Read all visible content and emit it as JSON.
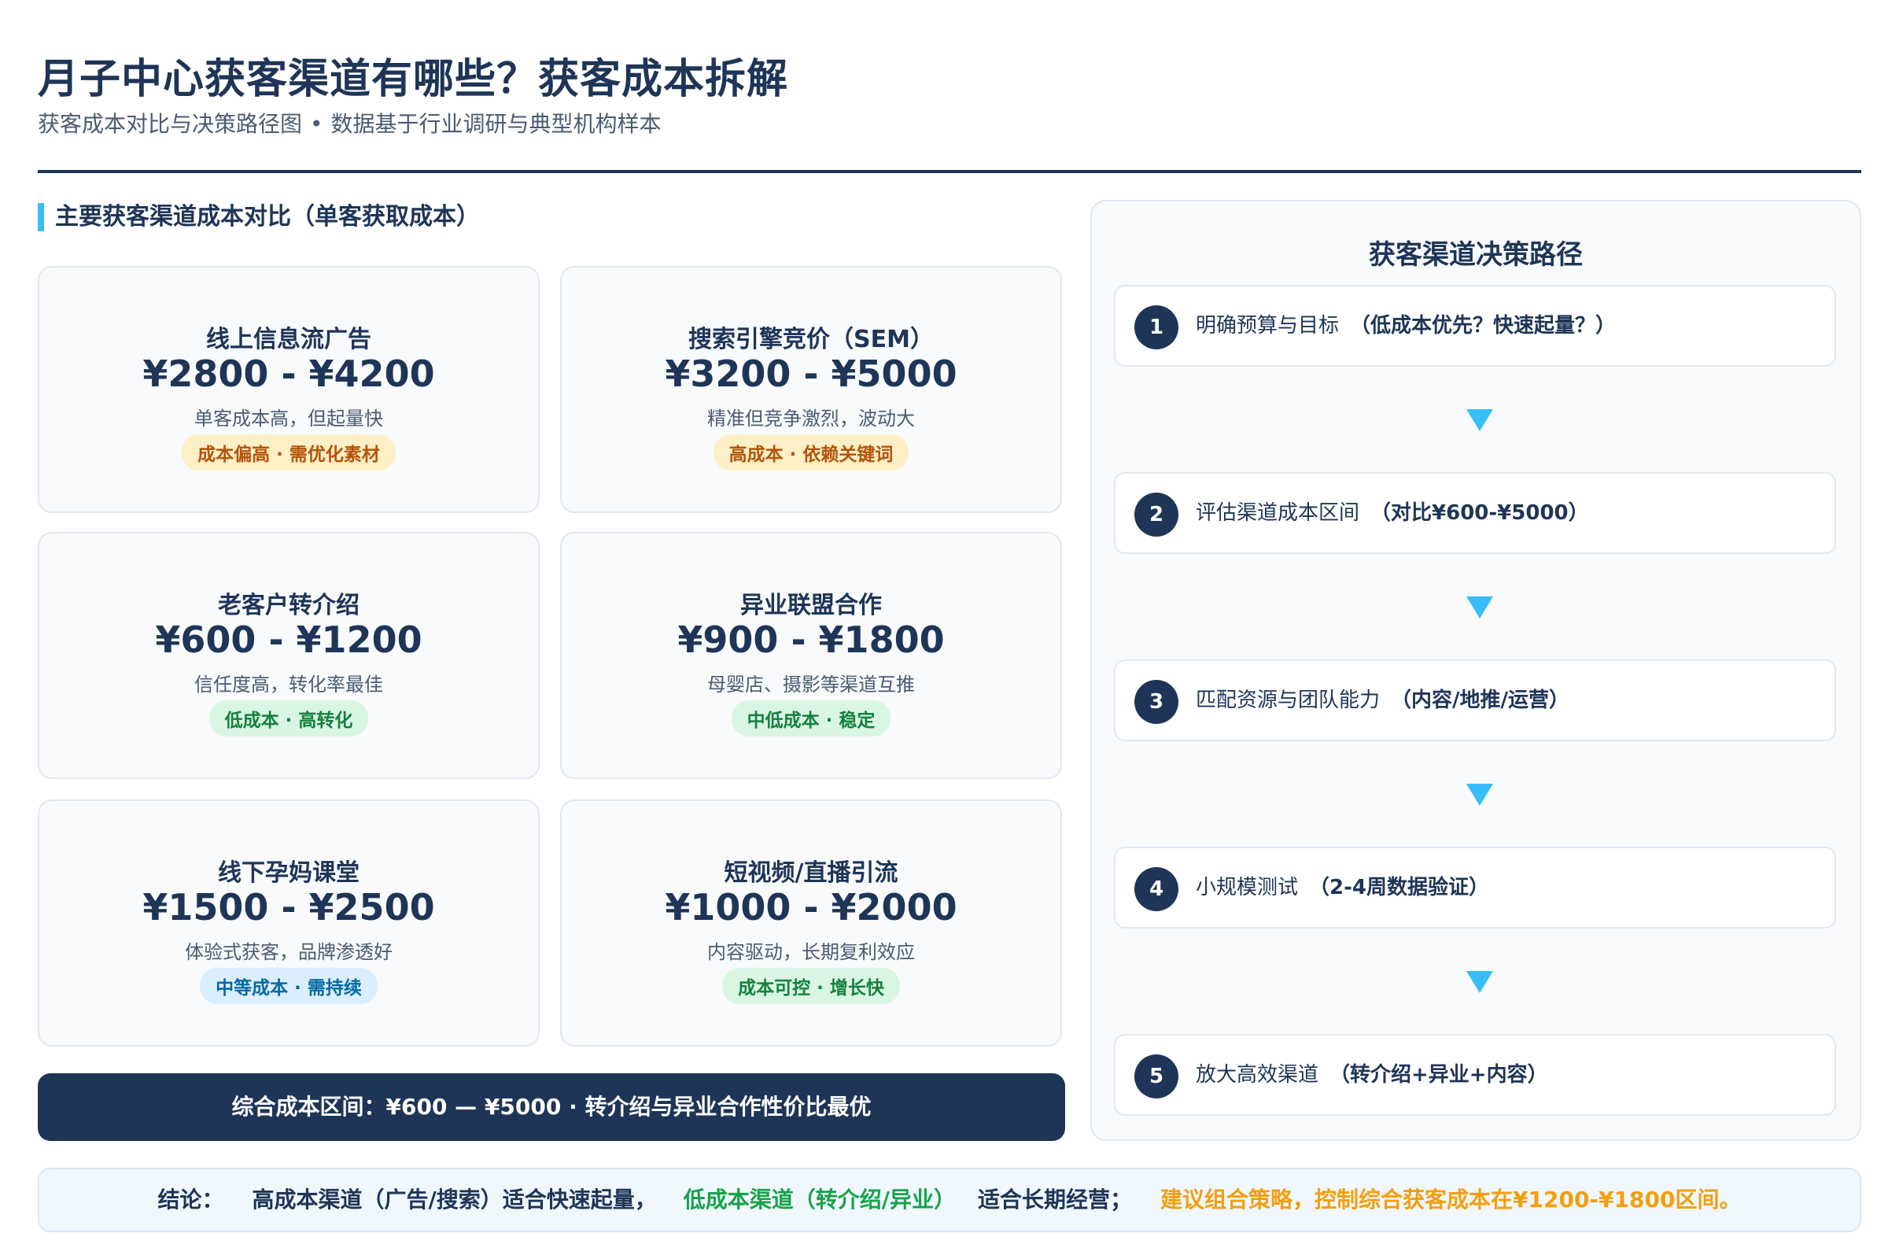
{
  "header": {
    "title": "月子中心获客渠道有哪些？获客成本拆解",
    "subtitle_left": "获客成本对比与决策路径图",
    "subtitle_sep": "•",
    "subtitle_right": "数据基于行业调研与典型机构样本"
  },
  "cost_section": {
    "heading": "主要获客渠道成本对比（单客获取成本）",
    "cards": [
      {
        "name": "线上信息流广告",
        "range": "¥2800 - ¥4200",
        "desc": "单客成本高，但起量快",
        "tag": "成本偏高 · 需优化素材",
        "tag_color": "#b45309"
      },
      {
        "name": "搜索引擎竞价（SEM）",
        "range": "¥3200 - ¥5000",
        "desc": "精准但竞争激烈，波动大",
        "tag": "高成本 · 依赖关键词",
        "tag_color": "#b45309"
      },
      {
        "name": "老客户转介绍",
        "range": "¥600 - ¥1200",
        "desc": "信任度高，转化率最佳",
        "tag": "低成本 · 高转化",
        "tag_color": "#15803d"
      },
      {
        "name": "异业联盟合作",
        "range": "¥900 - ¥1800",
        "desc": "母婴店、摄影等渠道互推",
        "tag": "中低成本 · 稳定",
        "tag_color": "#15803d"
      },
      {
        "name": "线下孕妈课堂",
        "range": "¥1500 - ¥2500",
        "desc": "体验式获客，品牌渗透好",
        "tag": "中等成本 · 需持续",
        "tag_color": "#0369a1"
      },
      {
        "name": "短视频/直播引流",
        "range": "¥1000 - ¥2000",
        "desc": "内容驱动，长期复利效应",
        "tag": "成本可控 · 增长快",
        "tag_color": "#15803d"
      }
    ],
    "summary": "综合成本区间：¥600 — ¥5000 · 转介绍与异业合作性价比最优"
  },
  "decision_panel": {
    "title": "获客渠道决策路径",
    "steps": [
      {
        "num": "1",
        "text": "明确预算与目标",
        "note": "（低成本优先？快速起量？）"
      },
      {
        "num": "2",
        "text": "评估渠道成本区间",
        "note": "（对比¥600-¥5000）"
      },
      {
        "num": "3",
        "text": "匹配资源与团队能力",
        "note": "（内容/地推/运营）"
      },
      {
        "num": "4",
        "text": "小规模测试",
        "note": "（2-4周数据验证）"
      },
      {
        "num": "5",
        "text": "放大高效渠道",
        "note": "（转介绍+异业+内容）"
      }
    ],
    "arrow_color": "#38bdf8"
  },
  "conclusion": {
    "lead": "结论：",
    "part1": "高成本渠道（广告/搜索）适合快速起量，",
    "part2": "低成本渠道（转介绍/异业）",
    "part3": "适合长期经营；",
    "part4": "建议组合策略，控制综合获客成本在¥1200-¥1800区间。"
  },
  "colors": {
    "navy": "#1e3557",
    "accent": "#38bdf8",
    "green": "#16a34a",
    "amber": "#f59e0b"
  }
}
